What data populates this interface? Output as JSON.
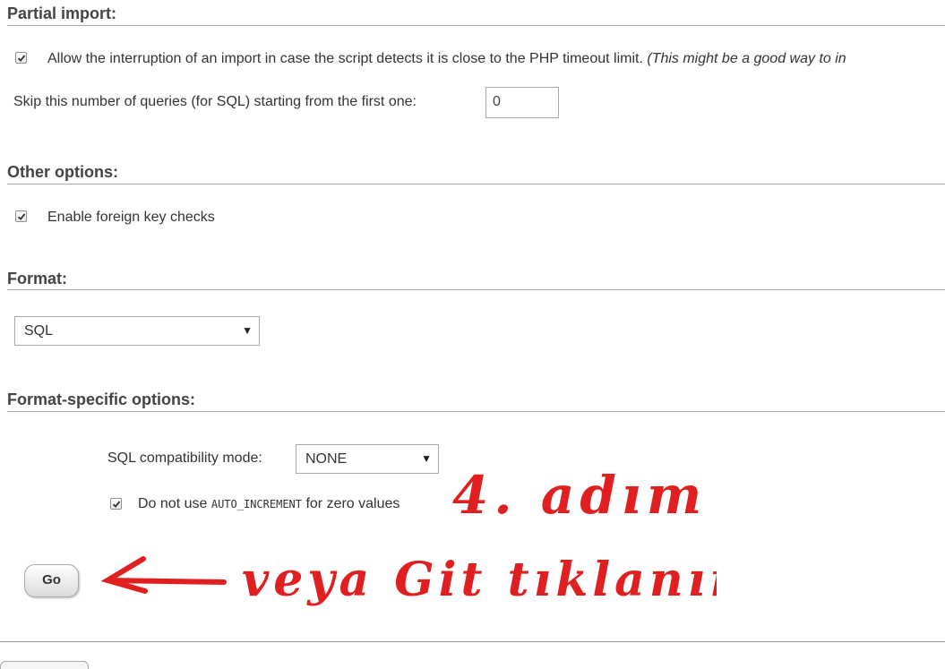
{
  "partial_import": {
    "heading": "Partial import:",
    "interrupt_label": "Allow the interruption of an import in case the script detects it is close to the PHP timeout limit.",
    "interrupt_note": "(This might be a good way to in",
    "skip_label": "Skip this number of queries (for SQL) starting from the first one:",
    "skip_value": "0"
  },
  "other_options": {
    "heading": "Other options:",
    "foreign_key_label": "Enable foreign key checks"
  },
  "format": {
    "heading": "Format:",
    "selected": "SQL"
  },
  "format_specific": {
    "heading": "Format-specific options:",
    "compat_label": "SQL compatibility mode:",
    "compat_selected": "NONE",
    "auto_inc_prefix": "Do not use",
    "auto_inc_code": "AUTO_INCREMENT",
    "auto_inc_suffix": "for zero values"
  },
  "actions": {
    "go_label": "Go"
  },
  "annotations": {
    "step": "4. adım",
    "instruction": "veya Git tıklanır"
  },
  "colors": {
    "annotation": "#e02020",
    "rule": "#aaaaaa"
  }
}
